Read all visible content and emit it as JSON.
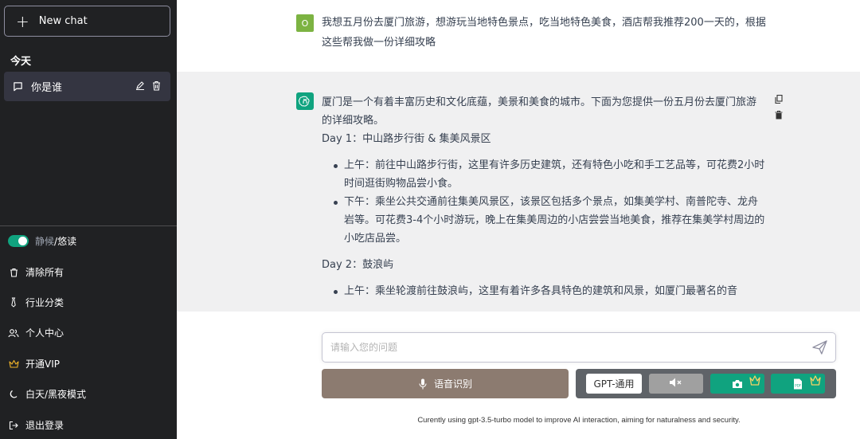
{
  "sidebar": {
    "new_chat_label": "New chat",
    "section_today": "今天",
    "chats": [
      {
        "title": "你是谁"
      }
    ],
    "mode": {
      "quiet": "静候",
      "separator": " / ",
      "active": "悠读"
    },
    "menu": {
      "clear_all": "清除所有",
      "categories": "行业分类",
      "profile": "个人中心",
      "vip": "开通VIP",
      "theme": "白天/黑夜模式",
      "logout": "退出登录"
    },
    "colors": {
      "background": "#202123",
      "active_item": "#343541",
      "toggle": "#10a37f",
      "vip_icon": "#f0b429"
    }
  },
  "conversation": {
    "user": {
      "avatar_letter": "O",
      "text": "我想五月份去厦门旅游，想游玩当地特色景点，吃当地特色美食，酒店帮我推荐200一天的，根据这些帮我做一份详细攻略"
    },
    "assistant": {
      "intro": "厦门是一个有着丰富历史和文化底蕴，美景和美食的城市。下面为您提供一份五月份去厦门旅游的详细攻略。",
      "day1_title": "Day 1：中山路步行街 & 集美风景区",
      "day1_items": [
        "上午：前往中山路步行街，这里有许多历史建筑，还有特色小吃和手工艺品等，可花费2小时时间逛街购物品尝小食。",
        "下午：乘坐公共交通前往集美风景区，该景区包括多个景点，如集美学村、南普陀寺、龙舟岩等。可花费3-4个小时游玩，晚上在集美周边的小店尝尝当地美食，推荐在集美学村周边的小吃店品尝。"
      ],
      "day2_title": "Day 2：鼓浪屿",
      "day2_items": [
        "上午：乘坐轮渡前往鼓浪屿，这里有着许多各具特色的建筑和风景，如厦门最著名的音"
      ]
    }
  },
  "composer": {
    "placeholder": "请输入您的问题",
    "voice_label": "语音识别",
    "model_label": "GPT-通用"
  },
  "footer": {
    "note": "Curently using gpt-3.5-turbo model to improve AI interaction, aiming for naturalness and security."
  },
  "icons": [
    "plus-icon",
    "chat-bubble-icon",
    "edit-icon",
    "trash-icon",
    "copy-icon",
    "delete-icon",
    "send-icon",
    "mic-icon",
    "speaker-mute-icon",
    "camera-icon",
    "pdf-icon",
    "vip-crown-icon",
    "trash-outline-icon",
    "tie-icon",
    "users-icon",
    "moon-icon",
    "logout-icon"
  ],
  "accent": {
    "brand_green": "#10a37f",
    "user_avatar": "#7cb342",
    "voice_button": "#8c7b70",
    "tool_panel": "#5f6368"
  }
}
